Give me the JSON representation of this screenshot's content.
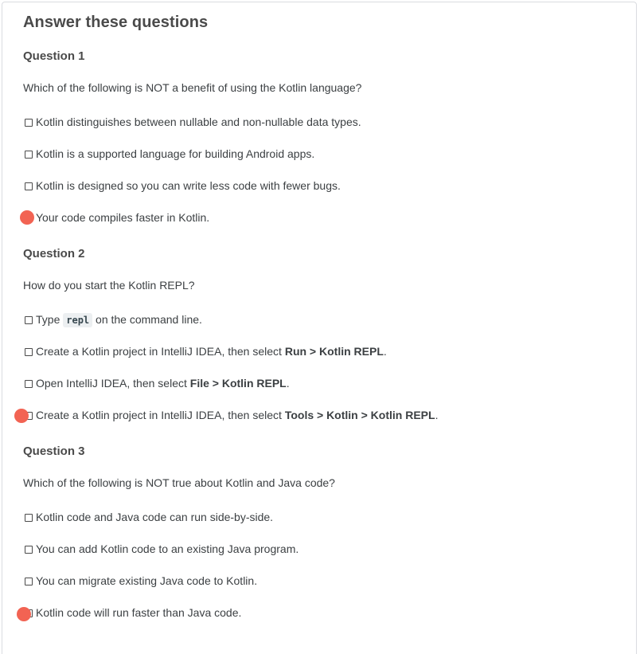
{
  "quiz": {
    "title": "Answer these questions",
    "questions": [
      {
        "heading": "Question 1",
        "prompt": "Which of the following is NOT a benefit of using the Kotlin language?",
        "options": [
          {
            "text": "Kotlin distinguishes between nullable and non-nullable data types."
          },
          {
            "text": "Kotlin is a supported language for building Android apps."
          },
          {
            "text": "Kotlin is designed so you can write less code with fewer bugs."
          },
          {
            "text": "Your code compiles faster in Kotlin."
          }
        ]
      },
      {
        "heading": "Question 2",
        "prompt": "How do you start the Kotlin REPL?",
        "options": [
          {
            "before": "Type ",
            "code": "repl",
            "after": " on the command line."
          },
          {
            "before": "Create a Kotlin project in IntelliJ IDEA, then select ",
            "bold": "Run > Kotlin REPL",
            "after": "."
          },
          {
            "before": "Open IntelliJ IDEA, then select ",
            "bold": "File > Kotlin REPL",
            "after": "."
          },
          {
            "before": "Create a Kotlin project in IntelliJ IDEA, then select ",
            "bold": "Tools > Kotlin > Kotlin REPL",
            "after": "."
          }
        ]
      },
      {
        "heading": "Question 3",
        "prompt": "Which of the following is NOT true about Kotlin and Java code?",
        "options": [
          {
            "text": "Kotlin code and Java code can run side-by-side."
          },
          {
            "text": "You can add Kotlin code to an existing Java program."
          },
          {
            "text": "You can migrate existing Java code to Kotlin."
          },
          {
            "text": "Kotlin code will run faster than Java code."
          }
        ]
      }
    ]
  },
  "colors": {
    "marker": "#f26353",
    "heading": "#4a4a4a",
    "text": "#3c4043",
    "card_border": "#dadce0"
  }
}
